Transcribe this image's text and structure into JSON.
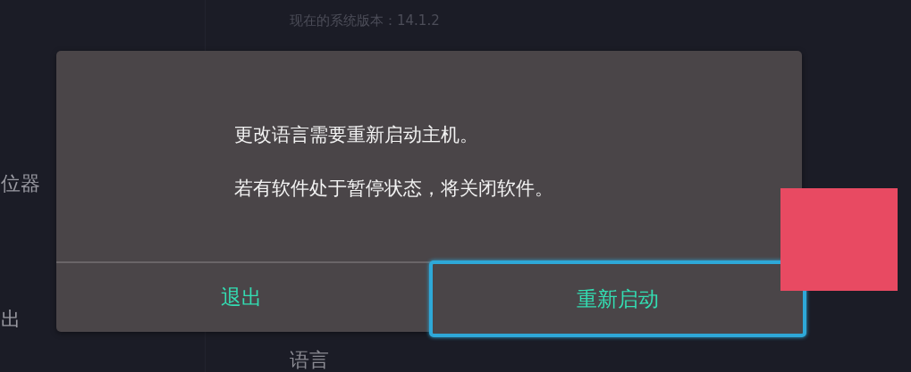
{
  "sidebar": {
    "items": [
      {
        "label": "位器"
      },
      {
        "label": "出"
      }
    ]
  },
  "main": {
    "version_text": "现在的系统版本：14.1.2",
    "section_heading": "语言"
  },
  "dialog": {
    "messages": [
      "更改语言需要重新启动主机。",
      "若有软件处于暂停状态，将关闭软件。"
    ],
    "buttons": [
      {
        "label": "退出",
        "selected": false
      },
      {
        "label": "重新启动",
        "selected": true
      }
    ]
  },
  "overlay": {
    "color": "#e84a62"
  }
}
